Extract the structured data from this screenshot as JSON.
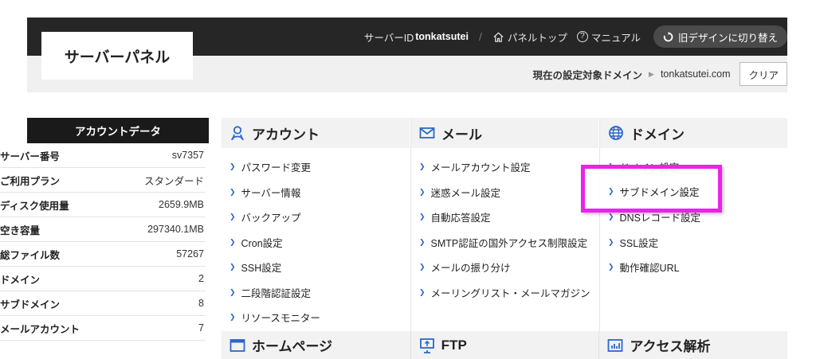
{
  "header": {
    "logo": "サーバーパネル",
    "server_id_label": "サーバーID",
    "server_id": "tonkatsutei",
    "panel_top": "パネルトップ",
    "manual": "マニュアル",
    "switch_design": "旧デザインに切り替え",
    "target_domain_label": "現在の設定対象ドメイン",
    "target_domain": "tonkatsutei.com",
    "clear": "クリア"
  },
  "account": {
    "title": "アカウントデータ",
    "rows": [
      {
        "key": "サーバー番号",
        "value": "sv7357"
      },
      {
        "key": "ご利用プラン",
        "value": "スタンダード"
      },
      {
        "key": "ディスク使用量",
        "value": "2659.9MB"
      },
      {
        "key": "空き容量",
        "value": "297340.1MB"
      },
      {
        "key": "総ファイル数",
        "value": "57267"
      },
      {
        "key": "ドメイン",
        "value": "2"
      },
      {
        "key": "サブドメイン",
        "value": "8"
      },
      {
        "key": "メールアカウント",
        "value": "7"
      }
    ]
  },
  "sections": {
    "account": {
      "title": "アカウント",
      "items": [
        "パスワード変更",
        "サーバー情報",
        "バックアップ",
        "Cron設定",
        "SSH設定",
        "二段階認証設定",
        "リソースモニター"
      ]
    },
    "mail": {
      "title": "メール",
      "items": [
        "メールアカウント設定",
        "迷惑メール設定",
        "自動応答設定",
        "SMTP認証の国外アクセス制限設定",
        "メールの振り分け",
        "メーリングリスト・メールマガジン"
      ]
    },
    "domain": {
      "title": "ドメイン",
      "items": [
        "ドメイン設定",
        "サブドメイン設定",
        "DNSレコード設定",
        "SSL設定",
        "動作確認URL"
      ]
    }
  },
  "footer_sections": {
    "homepage": "ホームページ",
    "ftp": "FTP",
    "access": "アクセス解析"
  },
  "colors": {
    "topbar": "#262626",
    "accent_link": "#2a68c8",
    "highlight": "#ec22ec"
  },
  "icons": {
    "account": "person-icon",
    "mail": "envelope-icon",
    "domain": "globe-icon",
    "homepage": "window-icon",
    "ftp": "monitor-upload-icon",
    "access": "bar-chart-icon"
  }
}
